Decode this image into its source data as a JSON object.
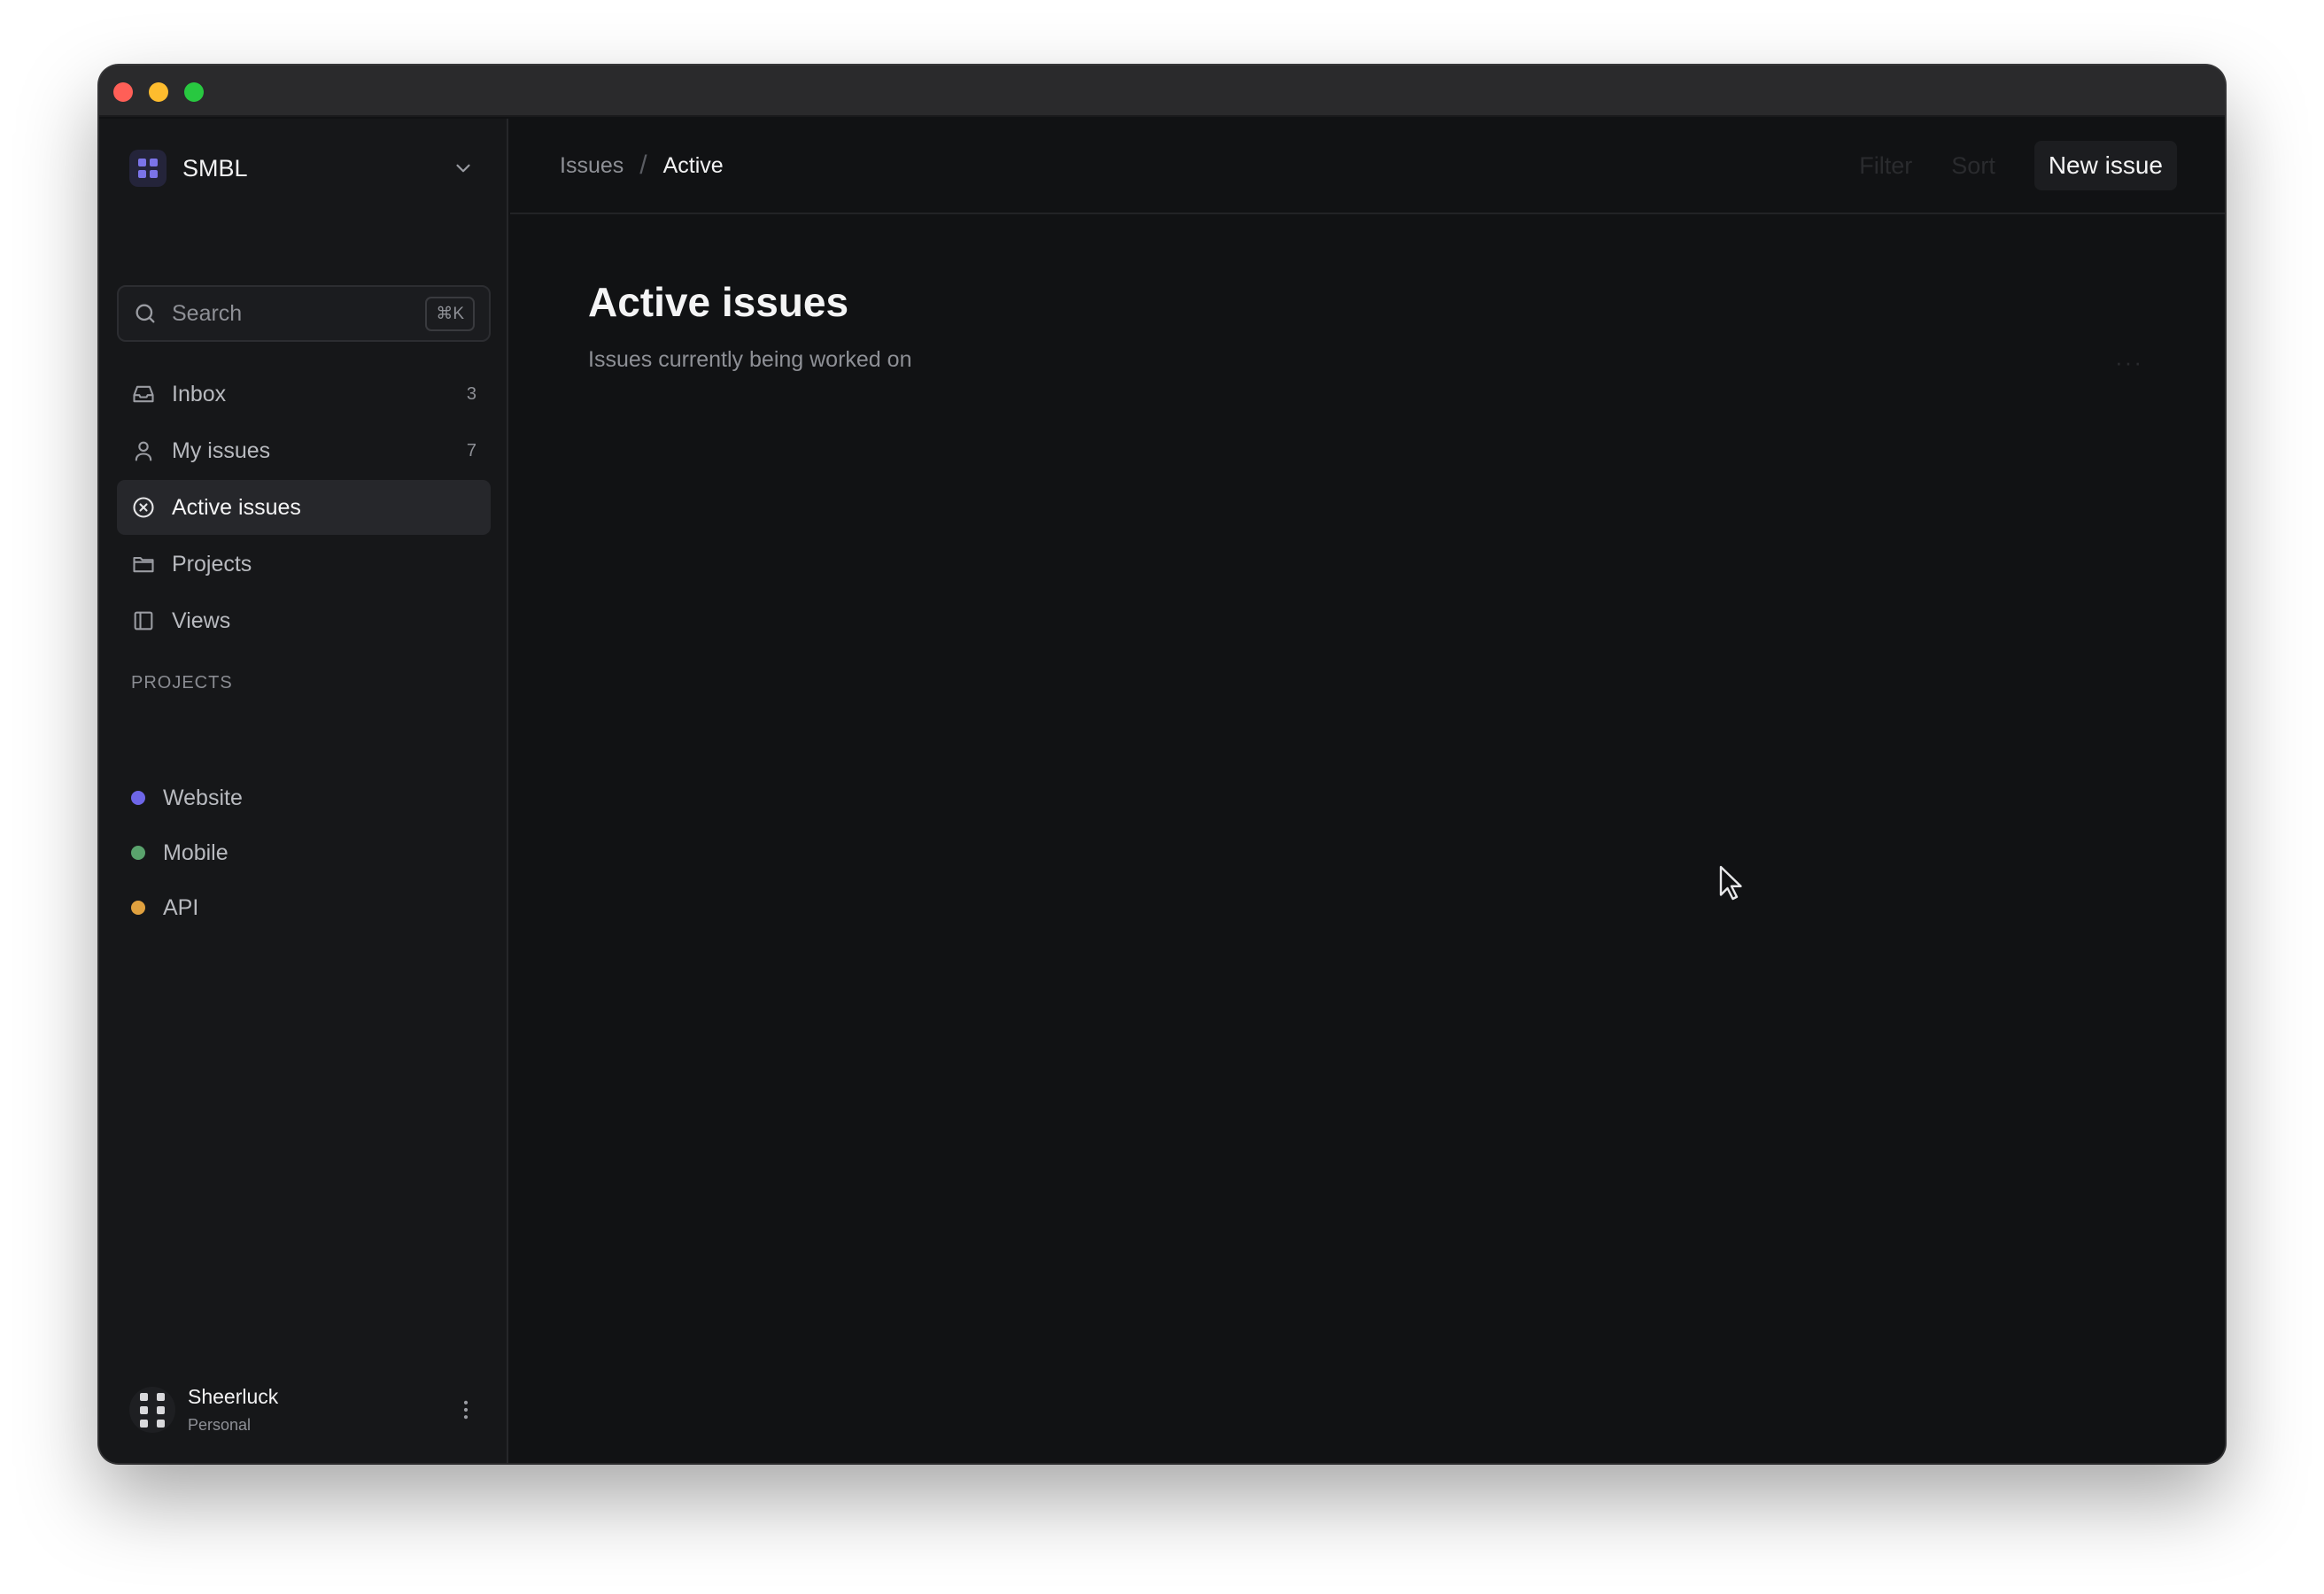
{
  "workspace": {
    "name": "SMBL",
    "logo_icon": "grid-logo-icon",
    "chevron_icon": "chevron-down-icon"
  },
  "search": {
    "placeholder": "Search",
    "shortcut": "⌘K"
  },
  "nav": [
    {
      "id": "inbox",
      "label": "Inbox",
      "count": "3",
      "icon": "inbox-icon"
    },
    {
      "id": "my-issues",
      "label": "My issues",
      "count": "7",
      "icon": "user-icon"
    },
    {
      "id": "active-issues",
      "label": "Active issues",
      "count": "",
      "icon": "circle-x-icon",
      "active": true
    },
    {
      "id": "projects",
      "label": "Projects",
      "count": "",
      "icon": "folder-icon"
    },
    {
      "id": "views",
      "label": "Views",
      "count": "",
      "icon": "layout-icon"
    }
  ],
  "projects_section": {
    "title": "PROJECTS",
    "items": [
      {
        "label": "Website",
        "color": "#6e66e8"
      },
      {
        "label": "Mobile",
        "color": "#5aa36d"
      },
      {
        "label": "API",
        "color": "#e0a13f"
      }
    ]
  },
  "user": {
    "name": "Sheerluck",
    "plan": "Personal"
  },
  "header": {
    "breadcrumb_parent": "Issues",
    "breadcrumb_separator": "/",
    "breadcrumb_current": "Active",
    "filter_label": "Filter",
    "sort_label": "Sort",
    "new_issue_label": "New issue"
  },
  "page": {
    "title": "Active issues",
    "subtitle": "Issues currently being worked on",
    "more_label": "···"
  },
  "colors": {
    "accent": "#7b74e8",
    "background": "#111214",
    "sidebar": "#161719"
  }
}
